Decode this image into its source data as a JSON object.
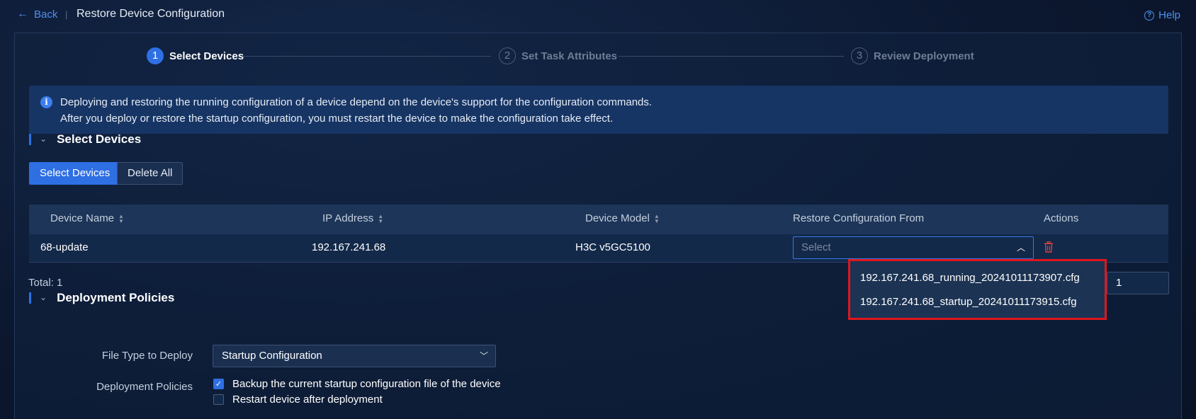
{
  "header": {
    "back_label": "Back",
    "separator": "|",
    "title": "Restore Device Configuration",
    "help_label": "Help"
  },
  "steps": [
    {
      "num": "1",
      "label": "Select Devices",
      "active": true
    },
    {
      "num": "2",
      "label": "Set Task Attributes",
      "active": false
    },
    {
      "num": "3",
      "label": "Review Deployment",
      "active": false
    }
  ],
  "info": {
    "line1": "Deploying and restoring the running configuration of a device depend on the device's support for the configuration commands.",
    "line2": "After you deploy or restore the startup configuration, you must restart the device to make the configuration take effect."
  },
  "select_devices_section": {
    "title": "Select Devices",
    "select_button": "Select Devices",
    "delete_all_button": "Delete All"
  },
  "table": {
    "columns": [
      "Device Name",
      "IP Address",
      "Device Model",
      "Restore Configuration From",
      "Actions"
    ],
    "rows": [
      {
        "device_name": "68-update",
        "ip_address": "192.167.241.68",
        "device_model": "H3C v5GC5100",
        "restore_from_placeholder": "Select"
      }
    ],
    "total_label": "Total: 1",
    "page_input": "1"
  },
  "dropdown": {
    "options": [
      "192.167.241.68_running_20241011173907.cfg",
      "192.167.241.68_startup_20241011173915.cfg"
    ]
  },
  "deployment_section": {
    "title": "Deployment Policies",
    "file_type_label": "File Type to Deploy",
    "file_type_value": "Startup Configuration",
    "policies_label": "Deployment Policies",
    "options": [
      {
        "label": "Backup the current startup configuration file of the device",
        "checked": true
      },
      {
        "label": "Restart device after deployment",
        "checked": false
      }
    ]
  },
  "colors": {
    "accent": "#2f6fe4",
    "highlight_border": "#e0161d",
    "delete_icon": "#d8433f"
  }
}
